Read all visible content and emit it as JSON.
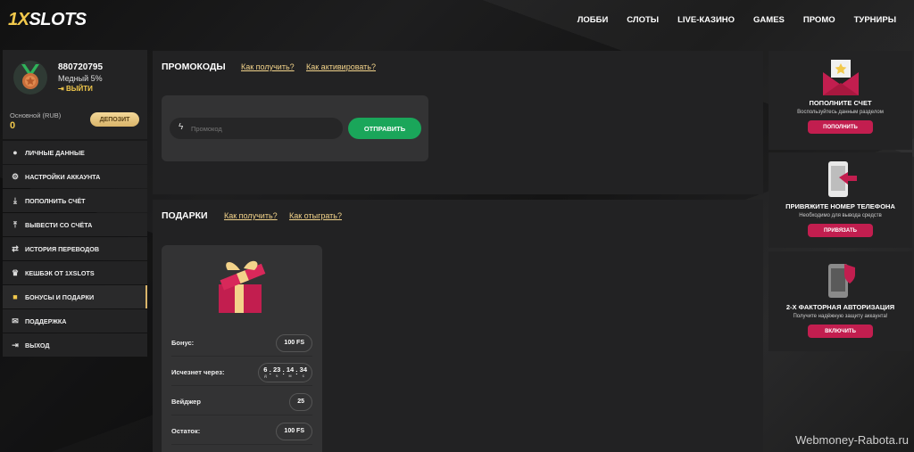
{
  "header": {
    "logo_prefix": "1X",
    "logo_suffix": "SLOTS",
    "nav": [
      "ЛОББИ",
      "СЛОТЫ",
      "LIVE-КАЗИНО",
      "GAMES",
      "ПРОМО",
      "ТУРНИРЫ"
    ]
  },
  "profile": {
    "account_id": "880720795",
    "rank": "Медный 5%",
    "logout": "ВЫЙТИ",
    "balance_label": "Основной (RUB)",
    "balance_value": "0",
    "deposit_label": "ДЕПОЗИТ"
  },
  "menu": [
    {
      "label": "ЛИЧНЫЕ ДАННЫЕ",
      "icon": "user-icon",
      "active": false
    },
    {
      "label": "НАСТРОЙКИ АККАУНТА",
      "icon": "gear-icon",
      "active": false
    },
    {
      "label": "ПОПОЛНИТЬ СЧЁТ",
      "icon": "download-icon",
      "active": false
    },
    {
      "label": "ВЫВЕСТИ СО СЧЁТА",
      "icon": "upload-icon",
      "active": false
    },
    {
      "label": "ИСТОРИЯ ПЕРЕВОДОВ",
      "icon": "transfer-icon",
      "active": false
    },
    {
      "label": "КЕШБЭК ОТ 1XSLOTS",
      "icon": "crown-icon",
      "active": false
    },
    {
      "label": "БОНУСЫ И ПОДАРКИ",
      "icon": "gift-icon",
      "active": true
    },
    {
      "label": "ПОДДЕРЖКА",
      "icon": "mail-icon",
      "active": false
    },
    {
      "label": "ВЫХОД",
      "icon": "exit-icon",
      "active": false
    }
  ],
  "promo": {
    "title": "ПРОМОКОДЫ",
    "link_how_get": "Как получить?",
    "link_how_activate": "Как активировать?",
    "input_placeholder": "Промокод",
    "send_label": "ОТПРАВИТЬ"
  },
  "gifts": {
    "title": "ПОДАРКИ",
    "link_how_get": "Как получить?",
    "link_how_wager": "Как отыграть?",
    "bonus_label": "Бонус:",
    "bonus_value": "100 FS",
    "expires_label": "Исчезнет через:",
    "timer": {
      "d": "6",
      "h": "23",
      "m": "14",
      "s": "34",
      "u_d": "д",
      "u_h": "ч",
      "u_m": "м",
      "u_s": "с"
    },
    "wager_label": "Вейджер",
    "wager_value": "25",
    "remaining_label": "Остаток:",
    "remaining_value": "100 FS"
  },
  "side": {
    "topup": {
      "title": "ПОПОЛНИТЕ СЧЕТ",
      "sub": "Воспользуйтесь данным разделом",
      "btn": "ПОПОЛНИТЬ"
    },
    "phone": {
      "title": "ПРИВЯЖИТЕ НОМЕР ТЕЛЕФОНА",
      "sub": "Необходимо для вывода средств",
      "btn": "ПРИВЯЗАТЬ"
    },
    "twofa": {
      "title": "2-Х ФАКТОРНАЯ АВТОРИЗАЦИЯ",
      "sub": "Получите надёжную защиту аккаунта!",
      "btn": "ВКЛЮЧИТЬ"
    }
  },
  "watermark": "Webmoney-Rabota.ru",
  "colors": {
    "accent_gold": "#f2c94c",
    "green": "#1aa65a",
    "crimson": "#c21e4f"
  }
}
